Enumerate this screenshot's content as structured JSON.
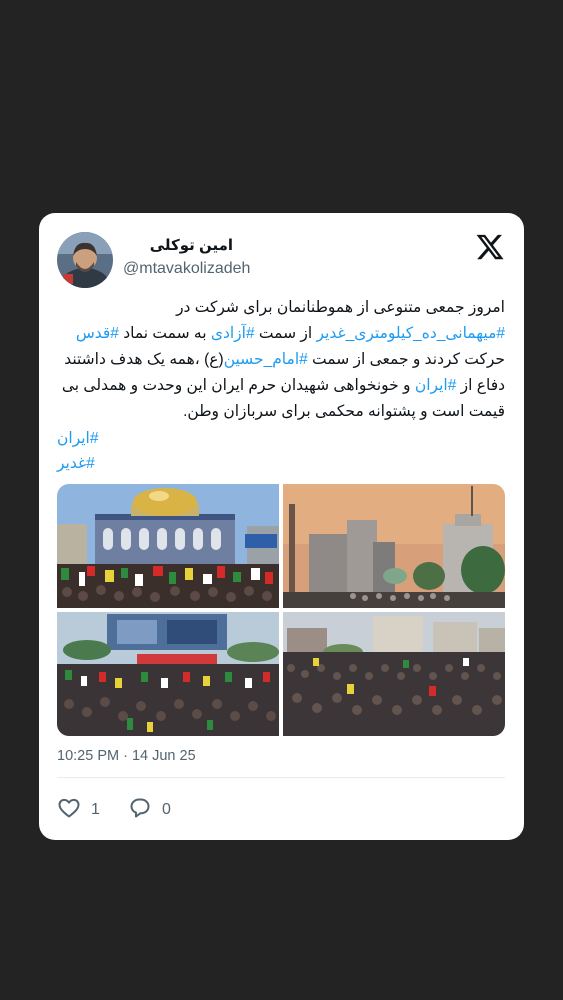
{
  "tweet": {
    "author_name": "امین توکلی",
    "author_handle": "@mtavakolizadeh",
    "platform_icon": "x-logo-icon",
    "text_parts": [
      {
        "t": "امروز جمعی متنوعی از هموطنانمان برای شرکت در ",
        "tag": false
      },
      {
        "t": "#میهمانی_ده_کیلومتری_غدیر",
        "tag": true
      },
      {
        "t": "  از سمت ",
        "tag": false
      },
      {
        "t": "#آزادی",
        "tag": true
      },
      {
        "t": " به سمت نماد ",
        "tag": false
      },
      {
        "t": "#قدس",
        "tag": true
      },
      {
        "t": " حرکت کردند و جمعی از سمت ",
        "tag": false
      },
      {
        "t": "#امام_حسین",
        "tag": true
      },
      {
        "t": "(ع) ،همه یک هدف داشتند دفاع از ",
        "tag": false
      },
      {
        "t": "#ایران",
        "tag": true
      },
      {
        "t": " و خونخواهی شهیدان حرم ایران این وحدت و همدلی بی قیمت است و پشتوانه محکمی برای سربازان وطن.",
        "tag": false
      }
    ],
    "hashtag_lines": [
      "#ایران",
      "#غدیر"
    ],
    "timestamp": "10:25 PM · 14 Jun 25",
    "likes_count": "1",
    "replies_count": "0",
    "like_icon": "heart-icon",
    "reply_icon": "reply-bubble-icon",
    "photos": [
      {
        "name": "photo-dome-rally",
        "sky": "#8fb5df"
      },
      {
        "name": "photo-street-dusk",
        "sky": "#e3ad82"
      },
      {
        "name": "photo-square-crowd",
        "sky": "#b9cbd8"
      },
      {
        "name": "photo-avenue-crowd",
        "sky": "#c8cfd6"
      }
    ],
    "colors": {
      "background": "#232323",
      "card": "#ffffff",
      "hashtag": "#1d9bf0",
      "secondary_text": "#536471",
      "primary_text": "#0f1419"
    }
  }
}
